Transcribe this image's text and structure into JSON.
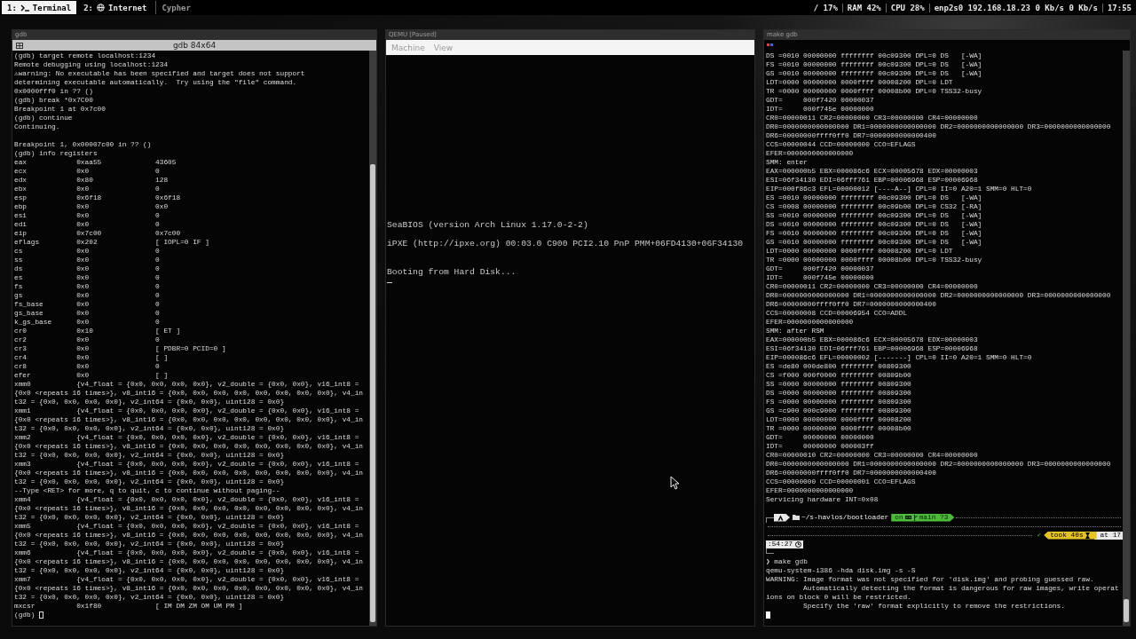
{
  "top_bar": {
    "workspaces": [
      {
        "number": "1:",
        "kind": "terminal",
        "label": "Terminal",
        "selected": true
      },
      {
        "number": "2:",
        "kind": "globe",
        "label": "Internet",
        "selected": false
      },
      {
        "label": "Cypher",
        "selected": false
      }
    ],
    "status": [
      "/ 17%",
      "RAM 42%",
      "CPU 28%",
      "enp2s0 192.168.18.23 0 Kb/s 0 Kb/s",
      "17:55"
    ]
  },
  "windows": [
    {
      "kind": "terminal",
      "title": "gdb",
      "header": "gdb 84x64",
      "lines": [
        {
          "kind": "text",
          "text": "(gdb) target remote localhost:1234"
        },
        {
          "kind": "text",
          "text": "Remote debugging using localhost:1234"
        },
        {
          "kind": "text",
          "text": "⚠warning: No executable has been specified and target does not support"
        },
        {
          "kind": "text",
          "text": "determining executable automatically.  Try using the \"file\" command."
        },
        {
          "kind": "text",
          "text": "0x0000fff0 in ?? ()"
        },
        {
          "kind": "text",
          "text": "(gdb) break *0x7C00"
        },
        {
          "kind": "text",
          "text": "Breakpoint 1 at 0x7c00"
        },
        {
          "kind": "text",
          "text": "(gdb) continue"
        },
        {
          "kind": "text",
          "text": "Continuing."
        },
        {
          "kind": "blank"
        },
        {
          "kind": "text",
          "text": "Breakpoint 1, 0x00007c00 in ?? ()"
        },
        {
          "kind": "text",
          "text": "(gdb) info registers"
        },
        {
          "kind": "register",
          "name": "eax",
          "value": "0xaa55",
          "natural": "43605"
        },
        {
          "kind": "register",
          "name": "ecx",
          "value": "0x0",
          "natural": "0"
        },
        {
          "kind": "register",
          "name": "edx",
          "value": "0x80",
          "natural": "128"
        },
        {
          "kind": "register",
          "name": "ebx",
          "value": "0x0",
          "natural": "0"
        },
        {
          "kind": "register",
          "name": "esp",
          "value": "0x6f18",
          "natural": "0x6f18"
        },
        {
          "kind": "register",
          "name": "ebp",
          "value": "0x0",
          "natural": "0x0"
        },
        {
          "kind": "register",
          "name": "esi",
          "value": "0x0",
          "natural": "0"
        },
        {
          "kind": "register",
          "name": "edi",
          "value": "0x0",
          "natural": "0"
        },
        {
          "kind": "register",
          "name": "eip",
          "value": "0x7c00",
          "natural": "0x7c00"
        },
        {
          "kind": "register",
          "name": "eflags",
          "value": "0x202",
          "natural": "[ IOPL=0 IF ]"
        },
        {
          "kind": "register",
          "name": "cs",
          "value": "0x0",
          "natural": "0"
        },
        {
          "kind": "register",
          "name": "ss",
          "value": "0x0",
          "natural": "0"
        },
        {
          "kind": "register",
          "name": "ds",
          "value": "0x0",
          "natural": "0"
        },
        {
          "kind": "register",
          "name": "es",
          "value": "0x0",
          "natural": "0"
        },
        {
          "kind": "register",
          "name": "fs",
          "value": "0x0",
          "natural": "0"
        },
        {
          "kind": "register",
          "name": "gs",
          "value": "0x0",
          "natural": "0"
        },
        {
          "kind": "register",
          "name": "fs_base",
          "value": "0x0",
          "natural": "0"
        },
        {
          "kind": "register",
          "name": "gs_base",
          "value": "0x0",
          "natural": "0"
        },
        {
          "kind": "register",
          "name": "k_gs_base",
          "value": "0x0",
          "natural": "0"
        },
        {
          "kind": "register",
          "name": "cr0",
          "value": "0x10",
          "natural": "[ ET ]"
        },
        {
          "kind": "register",
          "name": "cr2",
          "value": "0x0",
          "natural": "0"
        },
        {
          "kind": "register",
          "name": "cr3",
          "value": "0x0",
          "natural": "[ PDBR=0 PCID=0 ]"
        },
        {
          "kind": "register",
          "name": "cr4",
          "value": "0x0",
          "natural": "[ ]"
        },
        {
          "kind": "register",
          "name": "cr8",
          "value": "0x0",
          "natural": "0"
        },
        {
          "kind": "register",
          "name": "efer",
          "value": "0x0",
          "natural": "[ ]"
        },
        {
          "kind": "text",
          "text": "xmm0           {v4_float = {0x0, 0x0, 0x0, 0x0}, v2_double = {0x0, 0x0}, v16_int8 ="
        },
        {
          "kind": "text",
          "text": "{0x0 <repeats 16 times>}, v8_int16 = {0x0, 0x0, 0x0, 0x0, 0x0, 0x0, 0x0, 0x0}, v4_in"
        },
        {
          "kind": "text",
          "text": "t32 = {0x0, 0x0, 0x0, 0x0}, v2_int64 = {0x0, 0x0}, uint128 = 0x0}"
        },
        {
          "kind": "text",
          "text": "xmm1           {v4_float = {0x0, 0x0, 0x0, 0x0}, v2_double = {0x0, 0x0}, v16_int8 ="
        },
        {
          "kind": "text",
          "text": "{0x0 <repeats 16 times>}, v8_int16 = {0x0, 0x0, 0x0, 0x0, 0x0, 0x0, 0x0, 0x0}, v4_in"
        },
        {
          "kind": "text",
          "text": "t32 = {0x0, 0x0, 0x0, 0x0}, v2_int64 = {0x0, 0x0}, uint128 = 0x0}"
        },
        {
          "kind": "text",
          "text": "xmm2           {v4_float = {0x0, 0x0, 0x0, 0x0}, v2_double = {0x0, 0x0}, v16_int8 ="
        },
        {
          "kind": "text",
          "text": "{0x0 <repeats 16 times>}, v8_int16 = {0x0, 0x0, 0x0, 0x0, 0x0, 0x0, 0x0, 0x0}, v4_in"
        },
        {
          "kind": "text",
          "text": "t32 = {0x0, 0x0, 0x0, 0x0}, v2_int64 = {0x0, 0x0}, uint128 = 0x0}"
        },
        {
          "kind": "text",
          "text": "xmm3           {v4_float = {0x0, 0x0, 0x0, 0x0}, v2_double = {0x0, 0x0}, v16_int8 ="
        },
        {
          "kind": "text",
          "text": "{0x0 <repeats 16 times>}, v8_int16 = {0x0, 0x0, 0x0, 0x0, 0x0, 0x0, 0x0, 0x0}, v4_in"
        },
        {
          "kind": "text",
          "text": "t32 = {0x0, 0x0, 0x0, 0x0}, v2_int64 = {0x0, 0x0}, uint128 = 0x0}"
        },
        {
          "kind": "text",
          "text": "--Type <RET> for more, q to quit, c to continue without paging--"
        },
        {
          "kind": "text",
          "text": "xmm4           {v4_float = {0x0, 0x0, 0x0, 0x0}, v2_double = {0x0, 0x0}, v16_int8 ="
        },
        {
          "kind": "text",
          "text": "{0x0 <repeats 16 times>}, v8_int16 = {0x0, 0x0, 0x0, 0x0, 0x0, 0x0, 0x0, 0x0}, v4_in"
        },
        {
          "kind": "text",
          "text": "t32 = {0x0, 0x0, 0x0, 0x0}, v2_int64 = {0x0, 0x0}, uint128 = 0x0}"
        },
        {
          "kind": "text",
          "text": "xmm5           {v4_float = {0x0, 0x0, 0x0, 0x0}, v2_double = {0x0, 0x0}, v16_int8 ="
        },
        {
          "kind": "text",
          "text": "{0x0 <repeats 16 times>}, v8_int16 = {0x0, 0x0, 0x0, 0x0, 0x0, 0x0, 0x0, 0x0}, v4_in"
        },
        {
          "kind": "text",
          "text": "t32 = {0x0, 0x0, 0x0, 0x0}, v2_int64 = {0x0, 0x0}, uint128 = 0x0}"
        },
        {
          "kind": "text",
          "text": "xmm6           {v4_float = {0x0, 0x0, 0x0, 0x0}, v2_double = {0x0, 0x0}, v16_int8 ="
        },
        {
          "kind": "text",
          "text": "{0x0 <repeats 16 times>}, v8_int16 = {0x0, 0x0, 0x0, 0x0, 0x0, 0x0, 0x0, 0x0}, v4_in"
        },
        {
          "kind": "text",
          "text": "t32 = {0x0, 0x0, 0x0, 0x0}, v2_int64 = {0x0, 0x0}, uint128 = 0x0}"
        },
        {
          "kind": "text",
          "text": "xmm7           {v4_float = {0x0, 0x0, 0x0, 0x0}, v2_double = {0x0, 0x0}, v16_int8 ="
        },
        {
          "kind": "text",
          "text": "{0x0 <repeats 16 times>}, v8_int16 = {0x0, 0x0, 0x0, 0x0, 0x0, 0x0, 0x0, 0x0}, v4_in"
        },
        {
          "kind": "text",
          "text": "t32 = {0x0, 0x0, 0x0, 0x0}, v2_int64 = {0x0, 0x0}, uint128 = 0x0}"
        },
        {
          "kind": "register",
          "name": "mxcsr",
          "value": "0x1f80",
          "natural": "[ IM DM ZM OM UM PM ]"
        },
        {
          "kind": "input",
          "text": "(gdb)"
        }
      ]
    },
    {
      "kind": "vm",
      "title": "QEMU [Paused]",
      "menu": [
        "Machine",
        "View"
      ],
      "lines": [
        {
          "kind": "text",
          "text": "SeaBIOS (version Arch Linux 1.17.0-2-2)"
        },
        {
          "kind": "blank"
        },
        {
          "kind": "text",
          "text": "iPXE (http://ipxe.org) 00:03.0 C900 PCI2.10 PnP PMM+06FD4130+06F34130"
        },
        {
          "kind": "blank"
        },
        {
          "kind": "blank"
        },
        {
          "kind": "text",
          "text": "Booting from Hard Disk..."
        },
        {
          "kind": "underline_cursor"
        }
      ]
    },
    {
      "kind": "terminal",
      "title": "make gdb",
      "lines": [
        {
          "kind": "text",
          "text": "DS =0010 00000000 ffffffff 00c09300 DPL=0 DS   [-WA]"
        },
        {
          "kind": "text",
          "text": "FS =0010 00000000 ffffffff 00c09300 DPL=0 DS   [-WA]"
        },
        {
          "kind": "text",
          "text": "GS =0010 00000000 ffffffff 00c09300 DPL=0 DS   [-WA]"
        },
        {
          "kind": "text",
          "text": "LDT=0000 00000000 0000ffff 00008200 DPL=0 LDT"
        },
        {
          "kind": "text",
          "text": "TR =0000 00000000 0000ffff 00008b00 DPL=0 TSS32-busy"
        },
        {
          "kind": "text",
          "text": "GDT=     000f7420 00000037"
        },
        {
          "kind": "text",
          "text": "IDT=     000f745e 00000000"
        },
        {
          "kind": "text",
          "text": "CR0=00000011 CR2=00000000 CR3=00000000 CR4=00000000"
        },
        {
          "kind": "text",
          "text": "DR0=0000000000000000 DR1=0000000000000000 DR2=0000000000000000 DR3=0000000000000000"
        },
        {
          "kind": "text",
          "text": "DR6=00000000ffff0ff0 DR7=0000000000000400"
        },
        {
          "kind": "text",
          "text": "CCS=00000044 CCD=00000000 CCO=EFLAGS"
        },
        {
          "kind": "text",
          "text": "EFER=0000000000000000"
        },
        {
          "kind": "text",
          "text": "SMM: enter"
        },
        {
          "kind": "text",
          "text": "EAX=000000b5 EBX=000086c6 ECX=00005678 EDX=00000003"
        },
        {
          "kind": "text",
          "text": "ESI=06f34130 EDI=06fff761 EBP=00006968 ESP=00006968"
        },
        {
          "kind": "text",
          "text": "EIP=000f86c3 EFL=00000012 [----A--] CPL=0 II=0 A20=1 SMM=0 HLT=0"
        },
        {
          "kind": "text",
          "text": "ES =0010 00000000 ffffffff 00c09300 DPL=0 DS   [-WA]"
        },
        {
          "kind": "text",
          "text": "CS =0008 00000000 ffffffff 00c09b00 DPL=0 CS32 [-RA]"
        },
        {
          "kind": "text",
          "text": "SS =0010 00000000 ffffffff 00c09300 DPL=0 DS   [-WA]"
        },
        {
          "kind": "text",
          "text": "DS =0010 00000000 ffffffff 00c09300 DPL=0 DS   [-WA]"
        },
        {
          "kind": "text",
          "text": "FS =0010 00000000 ffffffff 00c09300 DPL=0 DS   [-WA]"
        },
        {
          "kind": "text",
          "text": "GS =0010 00000000 ffffffff 00c09300 DPL=0 DS   [-WA]"
        },
        {
          "kind": "text",
          "text": "LDT=0000 00000000 0000ffff 00008200 DPL=0 LDT"
        },
        {
          "kind": "text",
          "text": "TR =0000 00000000 0000ffff 00008b00 DPL=0 TSS32-busy"
        },
        {
          "kind": "text",
          "text": "GDT=     000f7420 00000037"
        },
        {
          "kind": "text",
          "text": "IDT=     000f745e 00000000"
        },
        {
          "kind": "text",
          "text": "CR0=00000011 CR2=00000000 CR3=00000000 CR4=00000000"
        },
        {
          "kind": "text",
          "text": "DR0=0000000000000000 DR1=0000000000000000 DR2=0000000000000000 DR3=0000000000000000"
        },
        {
          "kind": "text",
          "text": "DR6=00000000ffff0ff0 DR7=0000000000000400"
        },
        {
          "kind": "text",
          "text": "CCS=00000008 CCD=00006954 CCO=ADDL"
        },
        {
          "kind": "text",
          "text": "EFER=0000000000000000"
        },
        {
          "kind": "text",
          "text": "SMM: after RSM"
        },
        {
          "kind": "text",
          "text": "EAX=000000b5 EBX=000086c6 ECX=00005678 EDX=00000003"
        },
        {
          "kind": "text",
          "text": "ESI=06f34130 EDI=06fff761 EBP=00006968 ESP=00006968"
        },
        {
          "kind": "text",
          "text": "EIP=000086c6 EFL=00000002 [-------] CPL=0 II=0 A20=1 SMM=0 HLT=0"
        },
        {
          "kind": "text",
          "text": "ES =de80 000de800 ffffffff 00809300"
        },
        {
          "kind": "text",
          "text": "CS =f000 000f0000 ffffffff 00809b00"
        },
        {
          "kind": "text",
          "text": "SS =0000 00000000 ffffffff 00809300"
        },
        {
          "kind": "text",
          "text": "DS =0000 00000000 ffffffff 00809300"
        },
        {
          "kind": "text",
          "text": "FS =0000 00000000 ffffffff 00809300"
        },
        {
          "kind": "text",
          "text": "GS =c900 000c9000 ffffffff 00809300"
        },
        {
          "kind": "text",
          "text": "LDT=0000 00000000 0000ffff 00008200"
        },
        {
          "kind": "text",
          "text": "TR =0000 00000000 0000ffff 00008b00"
        },
        {
          "kind": "text",
          "text": "GDT=     00000000 00000000"
        },
        {
          "kind": "text",
          "text": "IDT=     00000000 000003ff"
        },
        {
          "kind": "text",
          "text": "CR0=00000010 CR2=00000000 CR3=00000000 CR4=00000000"
        },
        {
          "kind": "text",
          "text": "DR0=0000000000000000 DR1=0000000000000000 DR2=0000000000000000 DR3=0000000000000000"
        },
        {
          "kind": "text",
          "text": "DR6=00000000ffff0ff0 DR7=0000000000000400"
        },
        {
          "kind": "text",
          "text": "CCS=00000000 CCD=00000001 CCO=EFLAGS"
        },
        {
          "kind": "text",
          "text": "EFER=0000000000000000"
        },
        {
          "kind": "text",
          "text": "Servicing hardware INT=0x08"
        },
        {
          "kind": "blank"
        },
        {
          "kind": "prompt",
          "path": "~/s-havlos/bootloader",
          "vcs": "on",
          "branch": "main ?3",
          "status": "✓",
          "duration": "took 40s",
          "time_head": "at 17",
          "time_tail": ":54:27"
        },
        {
          "kind": "text",
          "text": "❯ make gdb"
        },
        {
          "kind": "text",
          "text": "qemu-system-i386 -hda disk.img -s -S"
        },
        {
          "kind": "text",
          "text": "WARNING: Image format was not specified for 'disk.img' and probing guessed raw."
        },
        {
          "kind": "text",
          "text": "         Automatically detecting the format is dangerous for raw images, write operat"
        },
        {
          "kind": "text",
          "text": "ions on block 0 will be restricted."
        },
        {
          "kind": "text",
          "text": "         Specify the 'raw' format explicitly to remove the restrictions."
        },
        {
          "kind": "block_cursor"
        }
      ]
    }
  ]
}
